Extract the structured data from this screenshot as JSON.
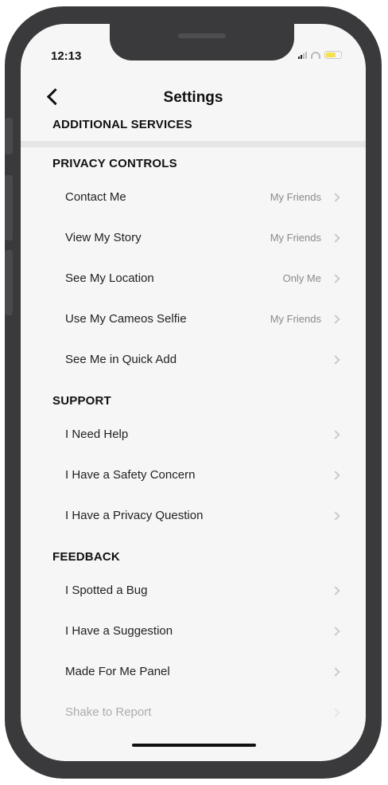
{
  "status_bar": {
    "time": "12:13"
  },
  "header": {
    "title": "Settings"
  },
  "sections": {
    "additional": {
      "title": "ADDITIONAL SERVICES"
    },
    "privacy": {
      "title": "PRIVACY CONTROLS",
      "items": [
        {
          "label": "Contact Me",
          "value": "My Friends"
        },
        {
          "label": "View My Story",
          "value": "My Friends"
        },
        {
          "label": "See My Location",
          "value": "Only Me"
        },
        {
          "label": "Use My Cameos Selfie",
          "value": "My Friends"
        },
        {
          "label": "See Me in Quick Add",
          "value": ""
        }
      ]
    },
    "support": {
      "title": "SUPPORT",
      "items": [
        {
          "label": "I Need Help"
        },
        {
          "label": "I Have a Safety Concern"
        },
        {
          "label": "I Have a Privacy Question"
        }
      ]
    },
    "feedback": {
      "title": "FEEDBACK",
      "items": [
        {
          "label": "I Spotted a Bug"
        },
        {
          "label": "I Have a Suggestion"
        },
        {
          "label": "Made For Me Panel"
        },
        {
          "label": "Shake to Report"
        }
      ]
    }
  },
  "colors": {
    "frame": "#3a3a3c",
    "background": "#f6f6f6",
    "value_text": "#8a8a8a"
  }
}
